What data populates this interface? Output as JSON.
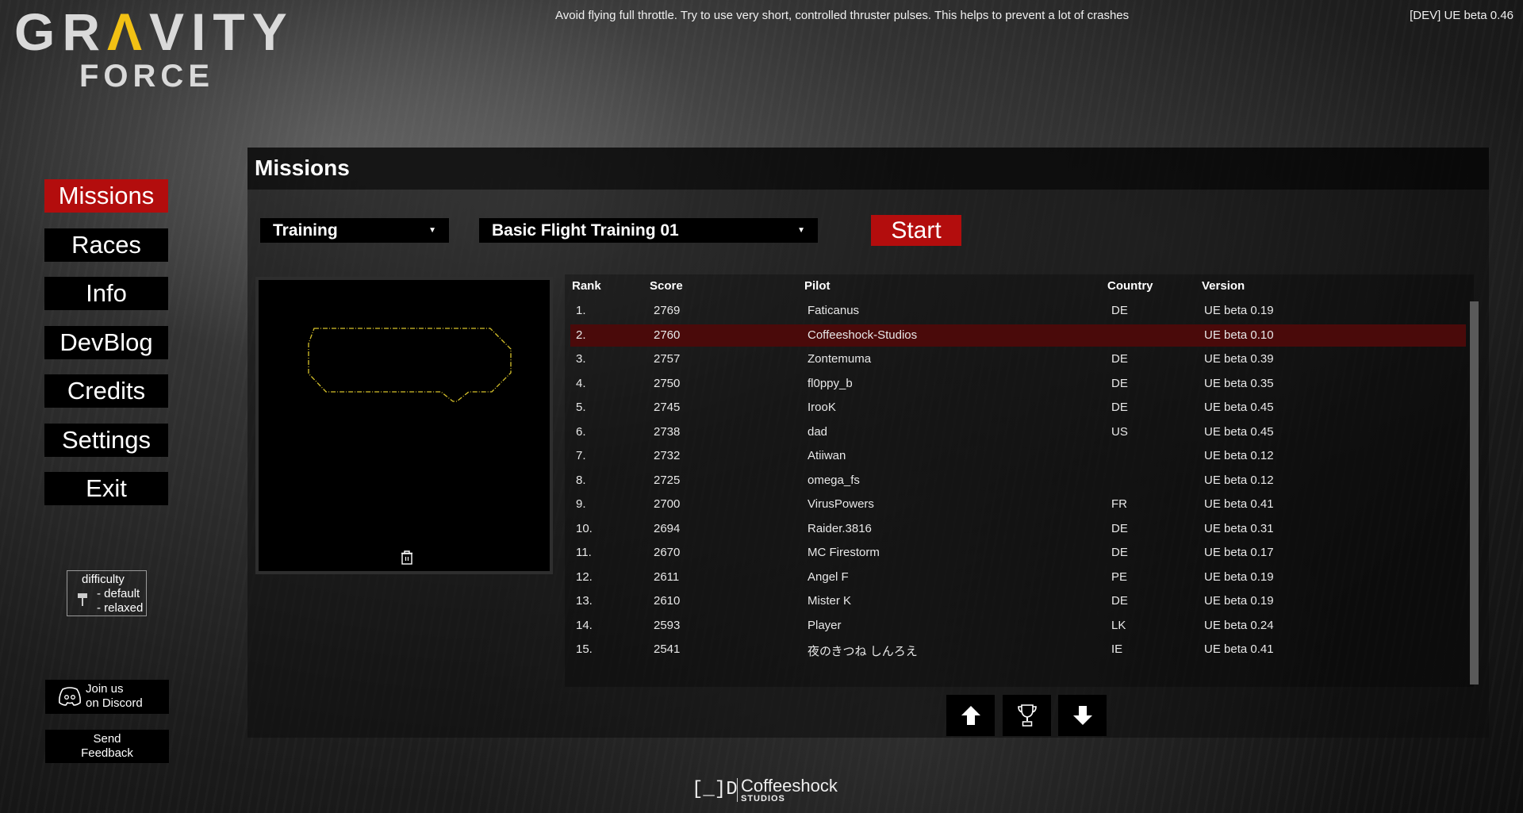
{
  "logo": {
    "line1": "GRAVITY",
    "line2": "FORCE"
  },
  "tip": "Avoid flying full throttle. Try to use very short, controlled thruster pulses. This helps to prevent a lot of crashes",
  "version": "[DEV] UE beta 0.46",
  "sidebar": {
    "items": [
      {
        "label": "Missions"
      },
      {
        "label": "Races"
      },
      {
        "label": "Info"
      },
      {
        "label": "DevBlog"
      },
      {
        "label": "Credits"
      },
      {
        "label": "Settings"
      },
      {
        "label": "Exit"
      }
    ]
  },
  "difficulty": {
    "title": "difficulty",
    "opt1": "- default",
    "opt2": "- relaxed"
  },
  "discord": {
    "line1": "Join us",
    "line2": "on Discord"
  },
  "feedback": {
    "line1": "Send",
    "line2": "Feedback"
  },
  "panel": {
    "title": "Missions",
    "category": "Training",
    "mission": "Basic Flight Training 01",
    "start": "Start"
  },
  "table": {
    "headers": [
      "Rank",
      "Score",
      "Pilot",
      "Country",
      "Version"
    ],
    "rows": [
      [
        "1.",
        "2769",
        "Faticanus",
        "DE",
        "UE beta 0.19"
      ],
      [
        "2.",
        "2760",
        "Coffeeshock-Studios",
        "",
        "UE beta 0.10"
      ],
      [
        "3.",
        "2757",
        "Zontemuma",
        "DE",
        "UE beta 0.39"
      ],
      [
        "4.",
        "2750",
        "fl0ppy_b",
        "DE",
        "UE beta 0.35"
      ],
      [
        "5.",
        "2745",
        "IrooK",
        "DE",
        "UE beta 0.45"
      ],
      [
        "6.",
        "2738",
        "dad",
        "US",
        "UE beta 0.45"
      ],
      [
        "7.",
        "2732",
        "Atiiwan",
        "",
        "UE beta 0.12"
      ],
      [
        "8.",
        "2725",
        "omega_fs",
        "",
        "UE beta 0.12"
      ],
      [
        "9.",
        "2700",
        "VirusPowers",
        "FR",
        "UE beta 0.41"
      ],
      [
        "10.",
        "2694",
        "Raider.3816",
        "DE",
        "UE beta 0.31"
      ],
      [
        "11.",
        "2670",
        "MC Firestorm",
        "DE",
        "UE beta 0.17"
      ],
      [
        "12.",
        "2611",
        "Angel F",
        "PE",
        "UE beta 0.19"
      ],
      [
        "13.",
        "2610",
        "Mister K",
        "DE",
        "UE beta 0.19"
      ],
      [
        "14.",
        "2593",
        "Player",
        "LK",
        "UE beta 0.24"
      ],
      [
        "15.",
        "2541",
        "夜のきつね しんろえ",
        "IE",
        "UE beta 0.41"
      ]
    ],
    "highlight_index": 1
  },
  "footer": {
    "brand": "Coffeeshock",
    "sub": "STUDIOS"
  },
  "colors": {
    "accent": "#b30d0d",
    "logo_yellow": "#f2c114"
  }
}
